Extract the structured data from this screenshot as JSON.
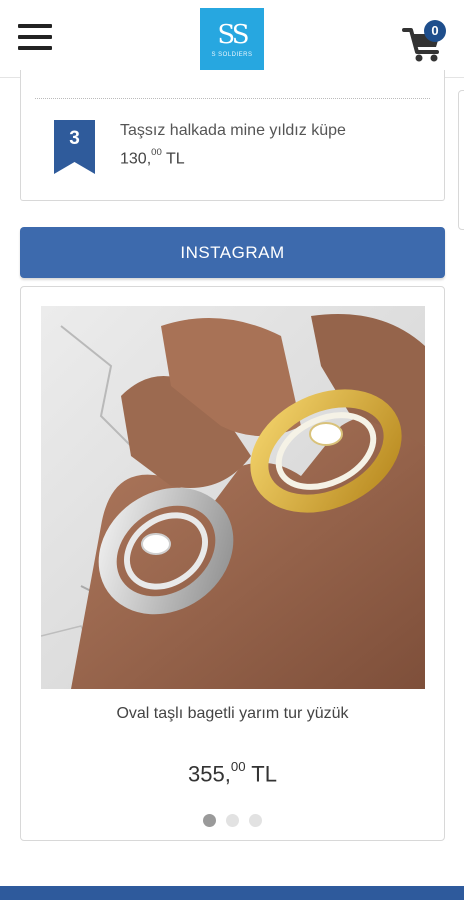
{
  "header": {
    "menu_icon": "hamburger-menu-icon",
    "logo_mark": "SS",
    "logo_text": "S SOLDIERS",
    "cart_icon": "shopping-cart-icon",
    "cart_count": "0"
  },
  "best_sellers": {
    "items": [
      {
        "rank": "3",
        "title": "Taşsız halkada mine yıldız küpe",
        "price_main": "130,",
        "price_cents": "00",
        "currency": "TL"
      }
    ]
  },
  "instagram": {
    "label": "INSTAGRAM"
  },
  "slide": {
    "title": "Oval taşlı bagetli yarım tur yüzük",
    "price_main": "355,",
    "price_cents": "00",
    "currency": "TL",
    "dots": 3,
    "active_dot": 1
  },
  "colors": {
    "brand_blue": "#3d6aad",
    "logo_blue": "#27a7e0",
    "badge_navy": "#1e4e8c",
    "ribbon": "#2f5b9b"
  }
}
